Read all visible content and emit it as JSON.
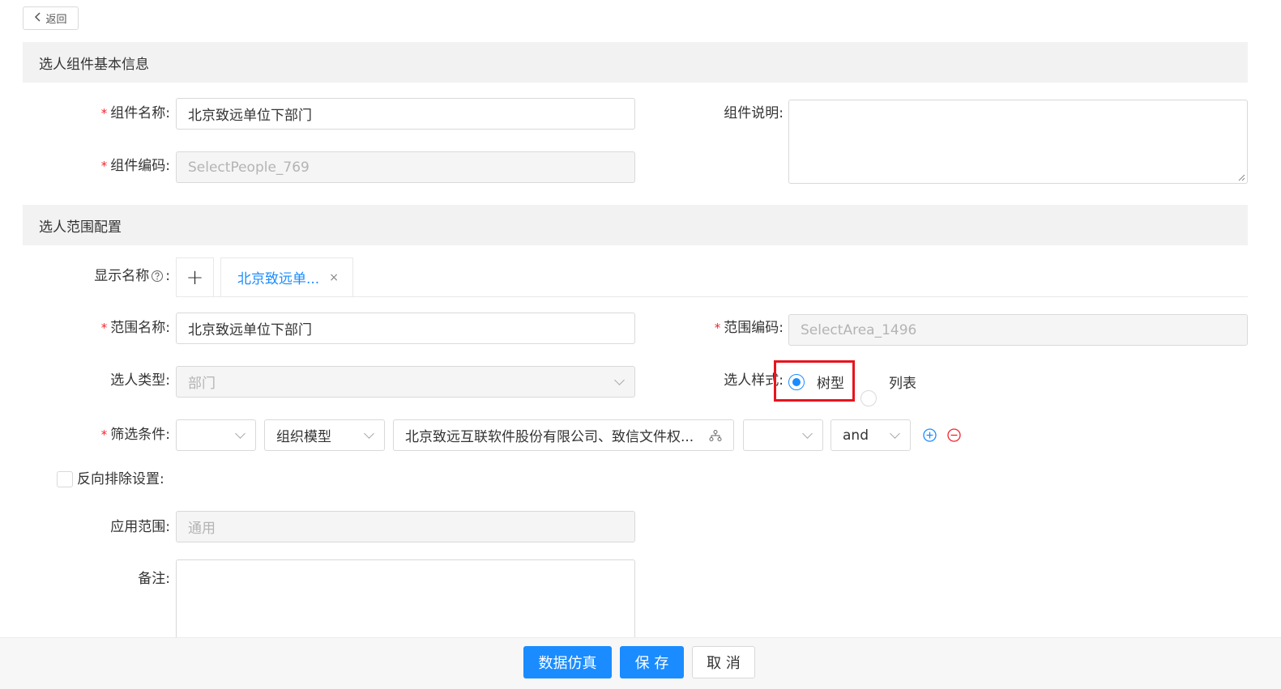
{
  "back_label": "返回",
  "sections": {
    "basic": "选人组件基本信息",
    "scope": "选人范围配置"
  },
  "component": {
    "name_label": "组件名称:",
    "name_value": "北京致远单位下部门",
    "code_label": "组件编码:",
    "code_value": "SelectPeople_769",
    "desc_label": "组件说明:",
    "desc_value": ""
  },
  "display_name": {
    "label": "显示名称",
    "help_icon": "question-circle-icon",
    "colon": ":",
    "add_symbol": "+",
    "tab_label": "北京致远单...",
    "tab_close": "×"
  },
  "scope": {
    "name_label": "范围名称:",
    "name_value": "北京致远单位下部门",
    "code_label": "范围编码:",
    "code_value": "SelectArea_1496",
    "type_label": "选人类型:",
    "type_value": "部门",
    "style_label": "选人样式:",
    "style_options": [
      "树型",
      "列表"
    ],
    "style_selected": "树型",
    "filter_label": "筛选条件:",
    "filter_select1": "",
    "filter_model": "组织模型",
    "filter_orgs": "北京致远互联软件股份有限公司、致信文件权...",
    "filter_select4": "",
    "filter_logic": "and",
    "reverse_label": "反向排除设置:",
    "reverse_checked": false,
    "apply_label": "应用范围:",
    "apply_value": "通用",
    "remark_label": "备注:",
    "remark_value": ""
  },
  "footer": {
    "simulate": "数据仿真",
    "save": "保 存",
    "cancel": "取 消"
  },
  "colors": {
    "primary": "#1a8cff",
    "required": "#f5222d",
    "highlight": "#e8141e"
  }
}
